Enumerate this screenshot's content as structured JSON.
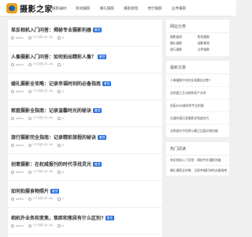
{
  "header": {
    "logo_text": "摄影之家",
    "nav": [
      "摄影器材",
      "影视摄影",
      "婚礼摄影",
      "摄影教程",
      "尝行摄影",
      "业界摄影"
    ]
  },
  "articles": [
    {
      "title": "单反相机入门问答：揭秘专业摄影利器",
      "author": "admin",
      "date": "2个月前 (01-16)",
      "views": "8"
    },
    {
      "title": "人像摄影入门问答：如何拍出精彩人像？",
      "author": "admin",
      "date": "2个月前 (01-16)",
      "views": "7"
    },
    {
      "title": "婚礼摄影全攻略：记录幸福时刻的必备指南",
      "author": "admin",
      "date": "2个月前 (01-16)",
      "views": "9"
    },
    {
      "title": "家庭摄影全指南：记录温馨时光的秘诀",
      "author": "admin",
      "date": "2个月前 (01-16)",
      "views": "6"
    },
    {
      "title": "旅行摄影完全指南：记录精彩旅程的秘诀",
      "author": "admin",
      "date": "2个月前 (01-16)",
      "views": "8"
    },
    {
      "title": "创意摄影：在权威报刊的时代寻找灵光",
      "author": "admin",
      "date": "2个月前 (01-16)",
      "views": "5"
    },
    {
      "title": "如何拍摄食物照片",
      "author": "admin",
      "date": "2个月前 (01-16)",
      "views": "7"
    },
    {
      "title": "相机外业务和变焦，焦距和焦段有什么区别?",
      "author": "admin",
      "date": "2个月前 (01-16)",
      "views": "6"
    }
  ],
  "badge_label": "置顶",
  "sidebar": {
    "categories_title": "网站分类",
    "categories": [
      "摄影器材",
      "影视摄影",
      "婚礼摄影",
      "摄影教程",
      "尝行摄影",
      "业界摄影"
    ],
    "recent_title": "最新文章",
    "recent": [
      "人像摄影中如何实现最佳对焦？",
      "怎样建立互动感和家产关系",
      "低配6000器材的专业拍摄",
      "沟通的幕后是摄影多角度技巧",
      "长焦镜头中用得以最正比值对焦拍摄"
    ],
    "hot_title": "热门阅读",
    "hot": [
      "单反相机入门问答：揭秘专业摄影利器",
      "婚礼摄影全攻略：记录幸福时刻的必备指南"
    ]
  }
}
